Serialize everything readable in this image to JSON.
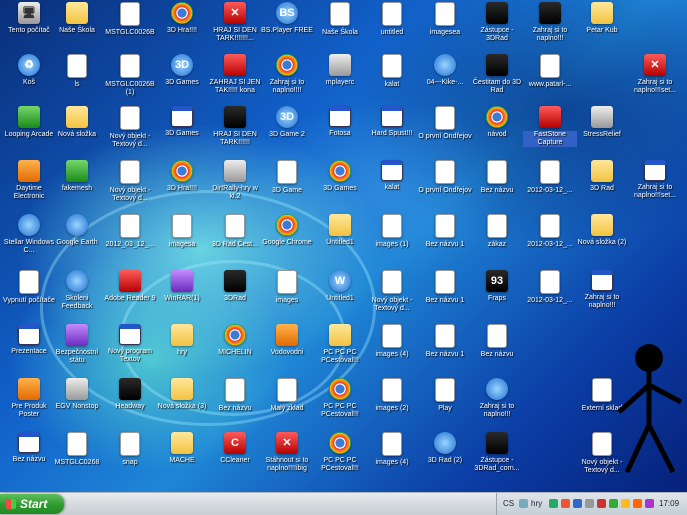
{
  "desktop": {
    "icons": [
      {
        "label": "Tento počítač",
        "icon": "computer-icon",
        "glyph": "🖥",
        "cls": "g-gray"
      },
      {
        "label": "Naše Škola",
        "icon": "folder-icon",
        "glyph": "",
        "cls": "g-folder"
      },
      {
        "label": "MSTGLC0026B",
        "icon": "document-icon",
        "glyph": "",
        "cls": "g-doc"
      },
      {
        "label": "3D Hra!!!!",
        "icon": "chrome-icon",
        "glyph": "",
        "cls": "g-chrome"
      },
      {
        "label": "HRAJ SI DEN TARK!!!!!!!...",
        "icon": "crossed-x-icon",
        "glyph": "✕",
        "cls": "g-red"
      },
      {
        "label": "BS.Player FREE",
        "icon": "player-icon",
        "glyph": "BS",
        "cls": "g-blue"
      },
      {
        "label": "Naše Škola",
        "icon": "document-icon",
        "glyph": "",
        "cls": "g-doc"
      },
      {
        "label": "untitled",
        "icon": "document-icon",
        "glyph": "",
        "cls": "g-doc"
      },
      {
        "label": "imagesea",
        "icon": "document-icon",
        "glyph": "",
        "cls": "g-doc"
      },
      {
        "label": "Zástupce - 3DRad",
        "icon": "app-icon",
        "glyph": "",
        "cls": "g-app"
      },
      {
        "label": "Zahraj si to naplno!!!",
        "icon": "app-icon",
        "glyph": "",
        "cls": "g-app"
      },
      {
        "label": "Petar Kub",
        "icon": "folder-icon",
        "glyph": "",
        "cls": "g-folder"
      },
      {
        "label": "Koš",
        "icon": "recycle-bin-icon",
        "glyph": "♻",
        "cls": "g-blue"
      },
      {
        "label": "ls",
        "icon": "document-icon",
        "glyph": "",
        "cls": "g-doc"
      },
      {
        "label": "MSTGLC0026B (1)",
        "icon": "document-icon",
        "glyph": "",
        "cls": "g-doc"
      },
      {
        "label": "3D Games",
        "icon": "app-icon",
        "glyph": "3D",
        "cls": "g-blue"
      },
      {
        "label": "ZAHRAJ SI JEN TAK!!!!! kona",
        "icon": "game-icon",
        "glyph": "",
        "cls": "g-red"
      },
      {
        "label": "Zahraj si to naplno!!!!",
        "icon": "chrome-icon",
        "glyph": "",
        "cls": "g-chrome"
      },
      {
        "label": "mplayerc",
        "icon": "film-icon",
        "glyph": "",
        "cls": "g-gray"
      },
      {
        "label": "kalat",
        "icon": "document-icon",
        "glyph": "",
        "cls": "g-doc"
      },
      {
        "label": "04---Kike-...",
        "icon": "player-icon",
        "glyph": "",
        "cls": "g-blue"
      },
      {
        "label": "Čestitam do 3D Rad",
        "icon": "app-icon",
        "glyph": "",
        "cls": "g-app"
      },
      {
        "label": "www.patarl-...",
        "icon": "document-icon",
        "glyph": "",
        "cls": "g-doc"
      },
      {
        "label": "Zahraj si to naplno!!!set...",
        "icon": "crossed-x-icon",
        "glyph": "✕",
        "cls": "g-red"
      },
      {
        "label": "Looping Arcade",
        "icon": "game-icon",
        "glyph": "",
        "cls": "g-green"
      },
      {
        "label": "Nová složka",
        "icon": "folder-icon",
        "glyph": "",
        "cls": "g-folder"
      },
      {
        "label": "Nový objekt - Textový d...",
        "icon": "document-icon",
        "glyph": "",
        "cls": "g-doc"
      },
      {
        "label": "3D Games",
        "icon": "window-icon",
        "glyph": "",
        "cls": "g-win"
      },
      {
        "label": "HRAJ SI DEN TARK!!!!!!",
        "icon": "app-icon",
        "glyph": "",
        "cls": "g-app"
      },
      {
        "label": "3D Game 2",
        "icon": "app-icon",
        "glyph": "3D",
        "cls": "g-blue"
      },
      {
        "label": "Fotosa",
        "icon": "window-icon",
        "glyph": "",
        "cls": "g-win"
      },
      {
        "label": "Hard Spust!!!",
        "icon": "window-icon",
        "glyph": "",
        "cls": "g-win"
      },
      {
        "label": "O první Ondřejov",
        "icon": "document-icon",
        "glyph": "",
        "cls": "g-doc"
      },
      {
        "label": "návod",
        "icon": "chrome-icon",
        "glyph": "",
        "cls": "g-chrome"
      },
      {
        "label": "FastStone Capture",
        "icon": "capture-icon",
        "glyph": "",
        "cls": "g-red",
        "selected": true
      },
      {
        "label": "StressRelief",
        "icon": "tool-icon",
        "glyph": "",
        "cls": "g-gray"
      },
      {
        "label": "Daytime Electronic",
        "icon": "game-icon",
        "glyph": "",
        "cls": "g-orange"
      },
      {
        "label": "fakemesh",
        "icon": "app-icon",
        "glyph": "",
        "cls": "g-green"
      },
      {
        "label": "Nový objekt - Textový d...",
        "icon": "document-icon",
        "glyph": "",
        "cls": "g-doc"
      },
      {
        "label": "3D Hra!!!!",
        "icon": "chrome-icon",
        "glyph": "",
        "cls": "g-chrome"
      },
      {
        "label": "DirtRally-hry w kl.2",
        "icon": "tool-icon",
        "glyph": "",
        "cls": "g-gray"
      },
      {
        "label": "3D Game",
        "icon": "document-icon",
        "glyph": "",
        "cls": "g-doc"
      },
      {
        "label": "3D Games",
        "icon": "chrome-icon",
        "glyph": "",
        "cls": "g-chrome"
      },
      {
        "label": "kalat",
        "icon": "window-icon",
        "glyph": "",
        "cls": "g-win"
      },
      {
        "label": "O první Ondřejov",
        "icon": "document-icon",
        "glyph": "",
        "cls": "g-doc"
      },
      {
        "label": "Bez názvu",
        "icon": "document-icon",
        "glyph": "",
        "cls": "g-doc"
      },
      {
        "label": "2012-03-12_...",
        "icon": "document-icon",
        "glyph": "",
        "cls": "g-doc"
      },
      {
        "label": "3D Rad",
        "icon": "folder-icon",
        "glyph": "",
        "cls": "g-folder"
      },
      {
        "label": "Zahraj si to naplno!!!set...",
        "icon": "window-icon",
        "glyph": "",
        "cls": "g-win"
      },
      {
        "label": "Stellar Windows C...",
        "icon": "game-icon",
        "glyph": "",
        "cls": "g-blue"
      },
      {
        "label": "Google Earth",
        "icon": "globe-icon",
        "glyph": "",
        "cls": "g-blue"
      },
      {
        "label": "2012_03_12_...",
        "icon": "document-icon",
        "glyph": "",
        "cls": "g-doc"
      },
      {
        "label": "imagesa",
        "icon": "document-icon",
        "glyph": "",
        "cls": "g-doc"
      },
      {
        "label": "3D Rad Čest...",
        "icon": "document-icon",
        "glyph": "",
        "cls": "g-doc"
      },
      {
        "label": "Google Chrome",
        "icon": "chrome-icon",
        "glyph": "",
        "cls": "g-chrome"
      },
      {
        "label": "Untitled1",
        "icon": "folder-icon",
        "glyph": "",
        "cls": "g-folder"
      },
      {
        "label": "images (1)",
        "icon": "document-icon",
        "glyph": "",
        "cls": "g-doc"
      },
      {
        "label": "Bez názvu 1",
        "icon": "document-icon",
        "glyph": "",
        "cls": "g-doc"
      },
      {
        "label": "zákaz",
        "icon": "document-icon",
        "glyph": "",
        "cls": "g-doc"
      },
      {
        "label": "2012-03-12_...",
        "icon": "document-icon",
        "glyph": "",
        "cls": "g-doc"
      },
      {
        "label": "Nová složka (2)",
        "icon": "folder-icon",
        "glyph": "",
        "cls": "g-folder"
      },
      {
        "label": "Vypnutí počítače",
        "icon": "document-icon",
        "glyph": "",
        "cls": "g-doc"
      },
      {
        "label": "Skoleni Feedback",
        "icon": "app-icon",
        "glyph": "",
        "cls": "g-blue"
      },
      {
        "label": "Adobe Reader 9",
        "icon": "pdf-icon",
        "glyph": "",
        "cls": "g-red"
      },
      {
        "label": "WinRAR(1)",
        "icon": "archive-icon",
        "glyph": "",
        "cls": "g-purple"
      },
      {
        "label": "3DRad",
        "icon": "app-icon",
        "glyph": "",
        "cls": "g-app"
      },
      {
        "label": "images",
        "icon": "document-icon",
        "glyph": "",
        "cls": "g-doc"
      },
      {
        "label": "Untitled1",
        "icon": "word-icon",
        "glyph": "W",
        "cls": "g-blue"
      },
      {
        "label": "Nový objekt - Textový d...",
        "icon": "document-icon",
        "glyph": "",
        "cls": "g-doc"
      },
      {
        "label": "Bez názvu 1",
        "icon": "document-icon",
        "glyph": "",
        "cls": "g-doc"
      },
      {
        "label": "Fraps",
        "icon": "app-icon",
        "glyph": "93",
        "cls": "g-app"
      },
      {
        "label": "2012-03-12_...",
        "icon": "document-icon",
        "glyph": "",
        "cls": "g-doc"
      },
      {
        "label": "Zahraj si to naplno!!!",
        "icon": "window-icon",
        "glyph": "",
        "cls": "g-win"
      },
      {
        "label": "Prezentace",
        "icon": "window-icon",
        "glyph": "",
        "cls": "g-win"
      },
      {
        "label": "Bezpečnostní státu",
        "icon": "app-icon",
        "glyph": "",
        "cls": "g-purple"
      },
      {
        "label": "Nový program Textov",
        "icon": "window-icon",
        "glyph": "",
        "cls": "g-win"
      },
      {
        "label": "hry",
        "icon": "folder-icon",
        "glyph": "",
        "cls": "g-folder"
      },
      {
        "label": "MICHELIN",
        "icon": "chrome-icon",
        "glyph": "",
        "cls": "g-chrome"
      },
      {
        "label": "Vodovodni",
        "icon": "tool-icon",
        "glyph": "",
        "cls": "g-orange"
      },
      {
        "label": "PC PC PC PCestoval!!!",
        "icon": "folder-icon",
        "glyph": "",
        "cls": "g-folder"
      },
      {
        "label": "images (4)",
        "icon": "document-icon",
        "glyph": "",
        "cls": "g-doc"
      },
      {
        "label": "Bez názvu 1",
        "icon": "document-icon",
        "glyph": "",
        "cls": "g-doc"
      },
      {
        "label": "Bez názvu",
        "icon": "document-icon",
        "glyph": "",
        "cls": "g-doc"
      },
      {
        "label": "Pre Produk Poster",
        "icon": "app-icon",
        "glyph": "",
        "cls": "g-orange"
      },
      {
        "label": "EGV Nonstop",
        "icon": "app-icon",
        "glyph": "",
        "cls": "g-gray"
      },
      {
        "label": "Headway",
        "icon": "app-icon",
        "glyph": "",
        "cls": "g-app"
      },
      {
        "label": "Nová složka (3)",
        "icon": "folder-icon",
        "glyph": "",
        "cls": "g-folder"
      },
      {
        "label": "Bez názvu",
        "icon": "document-icon",
        "glyph": "",
        "cls": "g-doc"
      },
      {
        "label": "Malý zklad",
        "icon": "document-icon",
        "glyph": "",
        "cls": "g-doc"
      },
      {
        "label": "PC PC PC PCestoval!!!",
        "icon": "chrome-icon",
        "glyph": "",
        "cls": "g-chrome"
      },
      {
        "label": "images (2)",
        "icon": "document-icon",
        "glyph": "",
        "cls": "g-doc"
      },
      {
        "label": "Play",
        "icon": "document-icon",
        "glyph": "",
        "cls": "g-doc"
      },
      {
        "label": "Zahraj si to naplno!!!",
        "icon": "app-icon",
        "glyph": "",
        "cls": "g-blue"
      },
      {
        "label": "Externí sklad",
        "icon": "document-icon",
        "glyph": "",
        "cls": "g-doc"
      },
      {
        "label": "Bez názvu",
        "icon": "window-icon",
        "glyph": "",
        "cls": "g-win"
      },
      {
        "label": "MSTGLC0268",
        "icon": "document-icon",
        "glyph": "",
        "cls": "g-doc"
      },
      {
        "label": "snap",
        "icon": "document-icon",
        "glyph": "",
        "cls": "g-doc"
      },
      {
        "label": "MACHE",
        "icon": "folder-icon",
        "glyph": "",
        "cls": "g-folder"
      },
      {
        "label": "CCleaner",
        "icon": "ccleaner-icon",
        "glyph": "C",
        "cls": "g-red"
      },
      {
        "label": "Stáhnout si to naplno!!!!ibig",
        "icon": "crossed-x-icon",
        "glyph": "✕",
        "cls": "g-red"
      },
      {
        "label": "PC PC PC PCestoval!!!",
        "icon": "chrome-icon",
        "glyph": "",
        "cls": "g-chrome"
      },
      {
        "label": "images (4)",
        "icon": "document-icon",
        "glyph": "",
        "cls": "g-doc"
      },
      {
        "label": "3D Rad (2)",
        "icon": "app-icon",
        "glyph": "",
        "cls": "g-blue"
      },
      {
        "label": "Zástupce - 3DRad_corn...",
        "icon": "app-icon",
        "glyph": "",
        "cls": "g-app"
      },
      {
        "label": "Nový objekt - Textový d...",
        "icon": "document-icon",
        "glyph": "",
        "cls": "g-doc"
      }
    ]
  },
  "taskbar": {
    "start_label": "Start",
    "lang": "CS",
    "tray_app": "hry",
    "clock": "17:09"
  },
  "colors": {
    "taskbar": "#d6dbe0",
    "start": "#2f9a2f"
  }
}
